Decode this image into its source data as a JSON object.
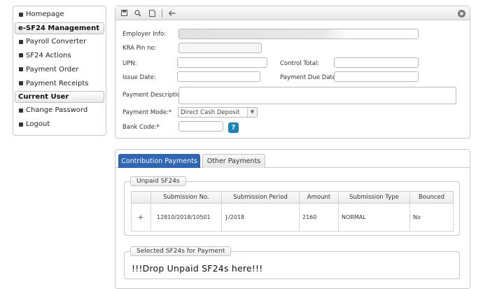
{
  "sidebar": {
    "items": [
      {
        "type": "link",
        "label": "Homepage"
      },
      {
        "type": "header",
        "label": "e-SF24 Management"
      },
      {
        "type": "link",
        "label": "Payroll Converter"
      },
      {
        "type": "link",
        "label": "SF24 Actions"
      },
      {
        "type": "link",
        "label": "Payment Order"
      },
      {
        "type": "link",
        "label": "Payment Receipts"
      },
      {
        "type": "header",
        "label": "Current User"
      },
      {
        "type": "link",
        "label": "Change Password"
      },
      {
        "type": "link",
        "label": "Logout"
      }
    ]
  },
  "toolbar": {
    "icons": [
      "save-icon",
      "search-icon",
      "new-document-icon",
      "back-arrow-icon",
      "settings-icon"
    ]
  },
  "form": {
    "employer_info_label": "Employer Info:",
    "kra_pin_label": "KRA Pin no:",
    "upn_label": "UPN:",
    "control_total_label": "Control Total:",
    "issue_date_label": "Issue Date:",
    "payment_due_date_label": "Payment Due Date:",
    "payment_description_label": "Payment Description:",
    "payment_mode_label": "Payment Mode:*",
    "payment_mode_value": "Direct Cash Deposit",
    "bank_code_label": "Bank Code:*",
    "help_icon_glyph": "?"
  },
  "tabs": [
    {
      "label": "Contribution Payments",
      "active": true
    },
    {
      "label": "Other Payments",
      "active": false
    }
  ],
  "unpaid": {
    "legend": "Unpaid SF24s",
    "columns": [
      "",
      "Submission No.",
      "Submission Period",
      "Amount",
      "Submission Type",
      "Bounced"
    ],
    "rows": [
      {
        "expand": "+",
        "submission_no": "12810/2018/10501",
        "period": "}/2018",
        "amount": "2160",
        "type": "NORMAL",
        "bounced": "No"
      }
    ]
  },
  "selected": {
    "legend": "Selected SF24s for Payment",
    "drop_text": "!!!Drop Unpaid SF24s here!!!"
  }
}
